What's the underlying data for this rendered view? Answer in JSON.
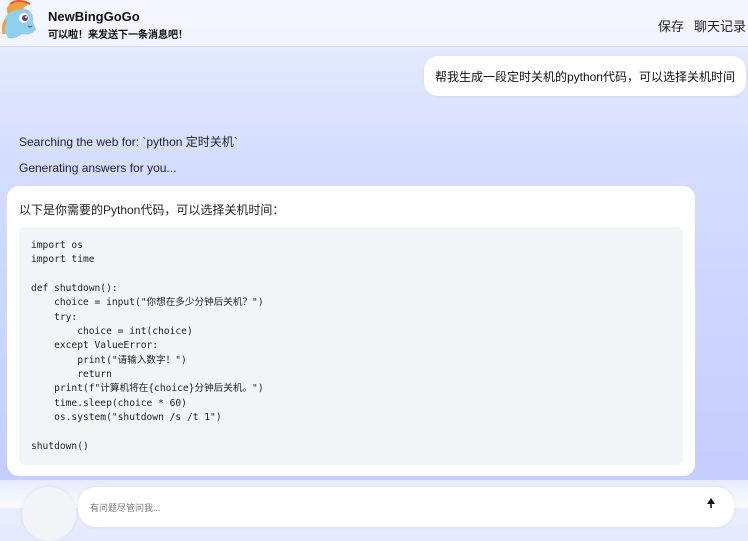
{
  "header": {
    "app_title": "NewBingGoGo",
    "app_subtitle": "可以啦！来发送下一条消息吧！",
    "save_label": "保存",
    "history_label": "聊天记录"
  },
  "conversation": {
    "user_message": "帮我生成一段定时关机的python代码，可以选择关机时间",
    "status_searching": "Searching the web for: `python 定时关机`",
    "status_generating": "Generating answers for you...",
    "bot_intro": "以下是你需要的Python代码，可以选择关机时间：",
    "code": "import os\nimport time\n\ndef shutdown():\n    choice = input(\"你想在多少分钟后关机？\")\n    try:\n        choice = int(choice)\n    except ValueError:\n        print(\"请输入数字！\")\n        return\n    print(f\"计算机将在{choice}分钟后关机。\")\n    time.sleep(choice * 60)\n    os.system(\"shutdown /s /t 1\")\n\nshutdown()"
  },
  "input": {
    "placeholder": "有问题尽管问我..."
  },
  "icons": {
    "logo": "pony-logo-icon",
    "send": "send-arrow-icon"
  },
  "colors": {
    "background_top": "#e9eeff",
    "background_bottom": "#c3ccff",
    "bubble": "#ffffff",
    "code_background": "#f3f4f8"
  }
}
